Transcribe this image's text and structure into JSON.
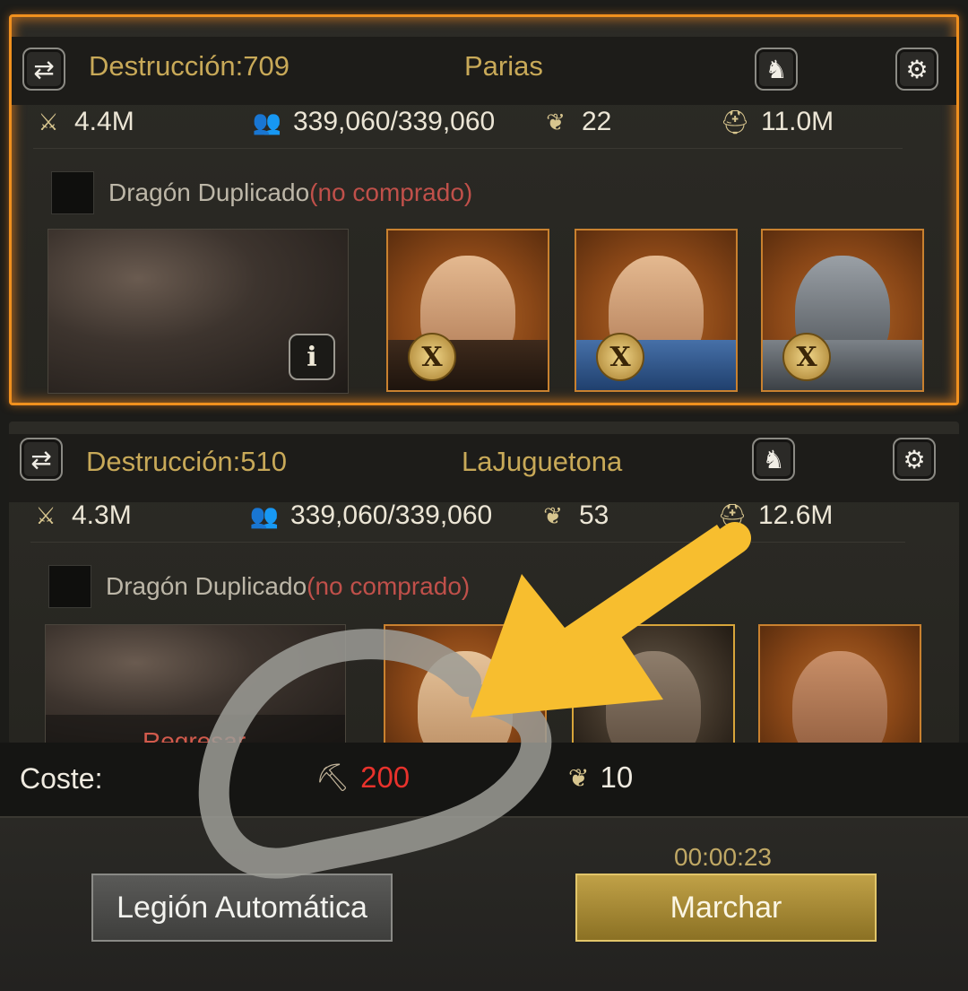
{
  "legions": [
    {
      "destruction_label": "Destrucción:709",
      "name": "Parias",
      "attack": "4.4M",
      "troops": "339,060/339,060",
      "stamina": "22",
      "defense": "11.0M",
      "dragon_label": "Dragón Duplicado",
      "dragon_status": "(no comprado)",
      "info_label": "i",
      "hero_badge": "X"
    },
    {
      "destruction_label": "Destrucción:510",
      "name": "LaJuguetona",
      "attack": "4.3M",
      "troops": "339,060/339,060",
      "stamina": "53",
      "defense": "12.6M",
      "dragon_label": "Dragón Duplicado",
      "dragon_status": "(no comprado)",
      "return_label": "Regresar"
    }
  ],
  "cost": {
    "label": "Coste:",
    "item_value": "200",
    "stamina_value": "10"
  },
  "footer": {
    "timer": "00:00:23",
    "auto_button": "Legión Automática",
    "march_button": "Marchar"
  },
  "icons": {
    "swap": "swap-icon",
    "formation": "formation-icon",
    "settings": "gear-icon",
    "attack": "crossed-swords-icon",
    "troops": "troops-icon",
    "stamina": "leaf-icon",
    "defense": "helmet-icon",
    "cost_item": "pickaxe-icon"
  },
  "colors": {
    "selected_border": "#f0901e",
    "cost_red": "#e8322c",
    "annotation_arrow": "#f7be2f",
    "annotation_circle": "#9c9c96"
  }
}
